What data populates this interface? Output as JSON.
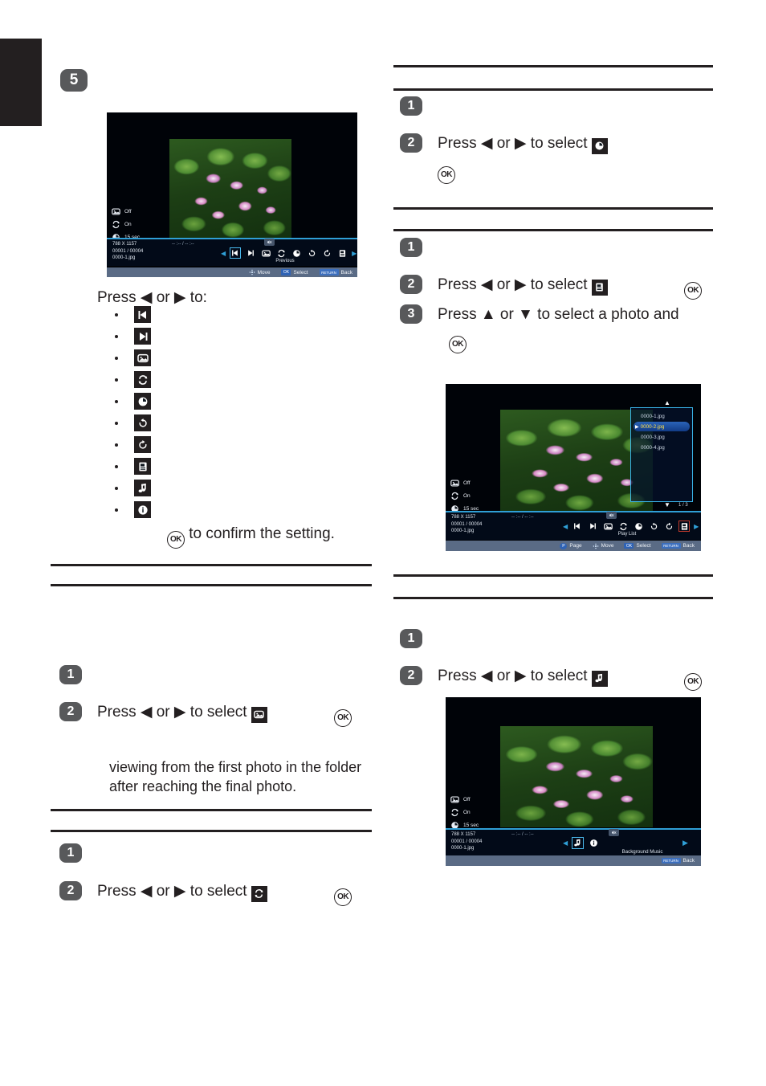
{
  "page": {
    "edge_tab": "section-tab"
  },
  "left_column": {
    "step5": {
      "number": "5"
    },
    "press_intro": "Press ◀ or ▶ to:",
    "bullet_icons": [
      "previous-icon",
      "next-icon",
      "slideshow-icon",
      "repeat-icon",
      "timer-icon",
      "rotate-left-icon",
      "rotate-right-icon",
      "playlist-icon",
      "music-icon",
      "info-icon"
    ],
    "confirm_text": "to confirm the setting.",
    "section_slideshow": {
      "step1": "1",
      "step2": "2",
      "step2_text_before": "Press ◀ or ▶ to select",
      "icon": "slideshow-icon",
      "note_line1": "viewing from the first photo in the folder",
      "note_line2": "after reaching the final photo."
    },
    "section_repeat": {
      "step1": "1",
      "step2": "2",
      "step2_text_before": "Press ◀ or ▶ to select",
      "icon": "repeat-icon"
    }
  },
  "right_column": {
    "section_timer": {
      "step1": "1",
      "step2": "2",
      "step2_text_before": "Press ◀ or ▶ to select",
      "icon": "timer-icon"
    },
    "section_playlist": {
      "step1": "1",
      "step2": "2",
      "step2_text_before": "Press ◀ or ▶ to select",
      "icon": "playlist-icon",
      "step3": "3",
      "step3_text": "Press ▲ or ▼ to select a photo and"
    },
    "section_music": {
      "step1": "1",
      "step2": "2",
      "step2_text_before": "Press ◀ or ▶ to select",
      "icon": "music-icon"
    }
  },
  "screenshot_viewer": {
    "osd": [
      {
        "icon": "slideshow-icon",
        "label": "Off"
      },
      {
        "icon": "repeat-icon",
        "label": "On"
      },
      {
        "icon": "timer-icon",
        "label": "15 sec"
      }
    ],
    "meta": {
      "resolution": "788 X 1157",
      "counter": "00001 / 00004",
      "filename": "0000-1.jpg"
    },
    "timecode": "-- :-- / -- :--",
    "mute_icon": "mute-icon",
    "toolbar": {
      "left_arrow": "prev-page-arrow",
      "right_arrow": "next-page-arrow",
      "buttons": [
        "previous-icon",
        "next-icon",
        "slideshow-icon",
        "repeat-icon",
        "timer-icon",
        "rotate-left-icon",
        "rotate-right-icon",
        "playlist-icon"
      ],
      "selected_index": 0,
      "label": "Previous"
    },
    "navbar": [
      {
        "key": "",
        "icon": "dpad-icon",
        "label": "Move"
      },
      {
        "key": "OK",
        "icon": "",
        "label": "Select"
      },
      {
        "key": "RETURN",
        "icon": "",
        "label": "Back"
      }
    ]
  },
  "screenshot_playlist": {
    "osd": [
      {
        "icon": "slideshow-icon",
        "label": "Off"
      },
      {
        "icon": "repeat-icon",
        "label": "On"
      },
      {
        "icon": "timer-icon",
        "label": "15 sec"
      }
    ],
    "meta": {
      "resolution": "788 X 1157",
      "counter": "00001 / 00004",
      "filename": "0000-1.jpg"
    },
    "timecode": "-- :-- / -- :--",
    "mute_icon": "mute-icon",
    "playlist": {
      "items": [
        {
          "name": "0000-1.jpg",
          "selected": false
        },
        {
          "name": "0000-2.jpg",
          "selected": true
        },
        {
          "name": "0000-3.jpg",
          "selected": false
        },
        {
          "name": "0000-4.jpg",
          "selected": false
        }
      ],
      "page_indicator": "1 / 3",
      "scroll_up": "▲",
      "scroll_down": "▼"
    },
    "toolbar": {
      "buttons": [
        "previous-icon",
        "next-icon",
        "slideshow-icon",
        "repeat-icon",
        "timer-icon",
        "rotate-left-icon",
        "rotate-right-icon",
        "playlist-icon"
      ],
      "selected_index": 7,
      "label": "Play List"
    },
    "navbar": [
      {
        "key": "P",
        "icon": "page-icon",
        "label": "Page"
      },
      {
        "key": "",
        "icon": "dpad-icon",
        "label": "Move"
      },
      {
        "key": "OK",
        "icon": "",
        "label": "Select"
      },
      {
        "key": "RETURN",
        "icon": "",
        "label": "Back"
      }
    ]
  },
  "screenshot_music": {
    "osd": [
      {
        "icon": "slideshow-icon",
        "label": "Off"
      },
      {
        "icon": "repeat-icon",
        "label": "On"
      },
      {
        "icon": "timer-icon",
        "label": "15 sec"
      }
    ],
    "meta": {
      "resolution": "788 X 1157",
      "counter": "00001 / 00004",
      "filename": "0000-1.jpg"
    },
    "timecode": "-- :-- / -- :--",
    "mute_icon": "mute-icon",
    "toolbar": {
      "buttons": [
        "music-icon",
        "info-icon"
      ],
      "selected_index": 0,
      "label": "Background Music"
    },
    "navbar": [
      {
        "key": "RETURN",
        "icon": "",
        "label": "Back"
      }
    ]
  },
  "colors": {
    "accent_blue": "#2f9fd6",
    "select_yellow": "#ffe14d",
    "panel_border": "#39b2e6",
    "navbar_bg": "#5a6b85",
    "step_badge": "#58595b"
  }
}
